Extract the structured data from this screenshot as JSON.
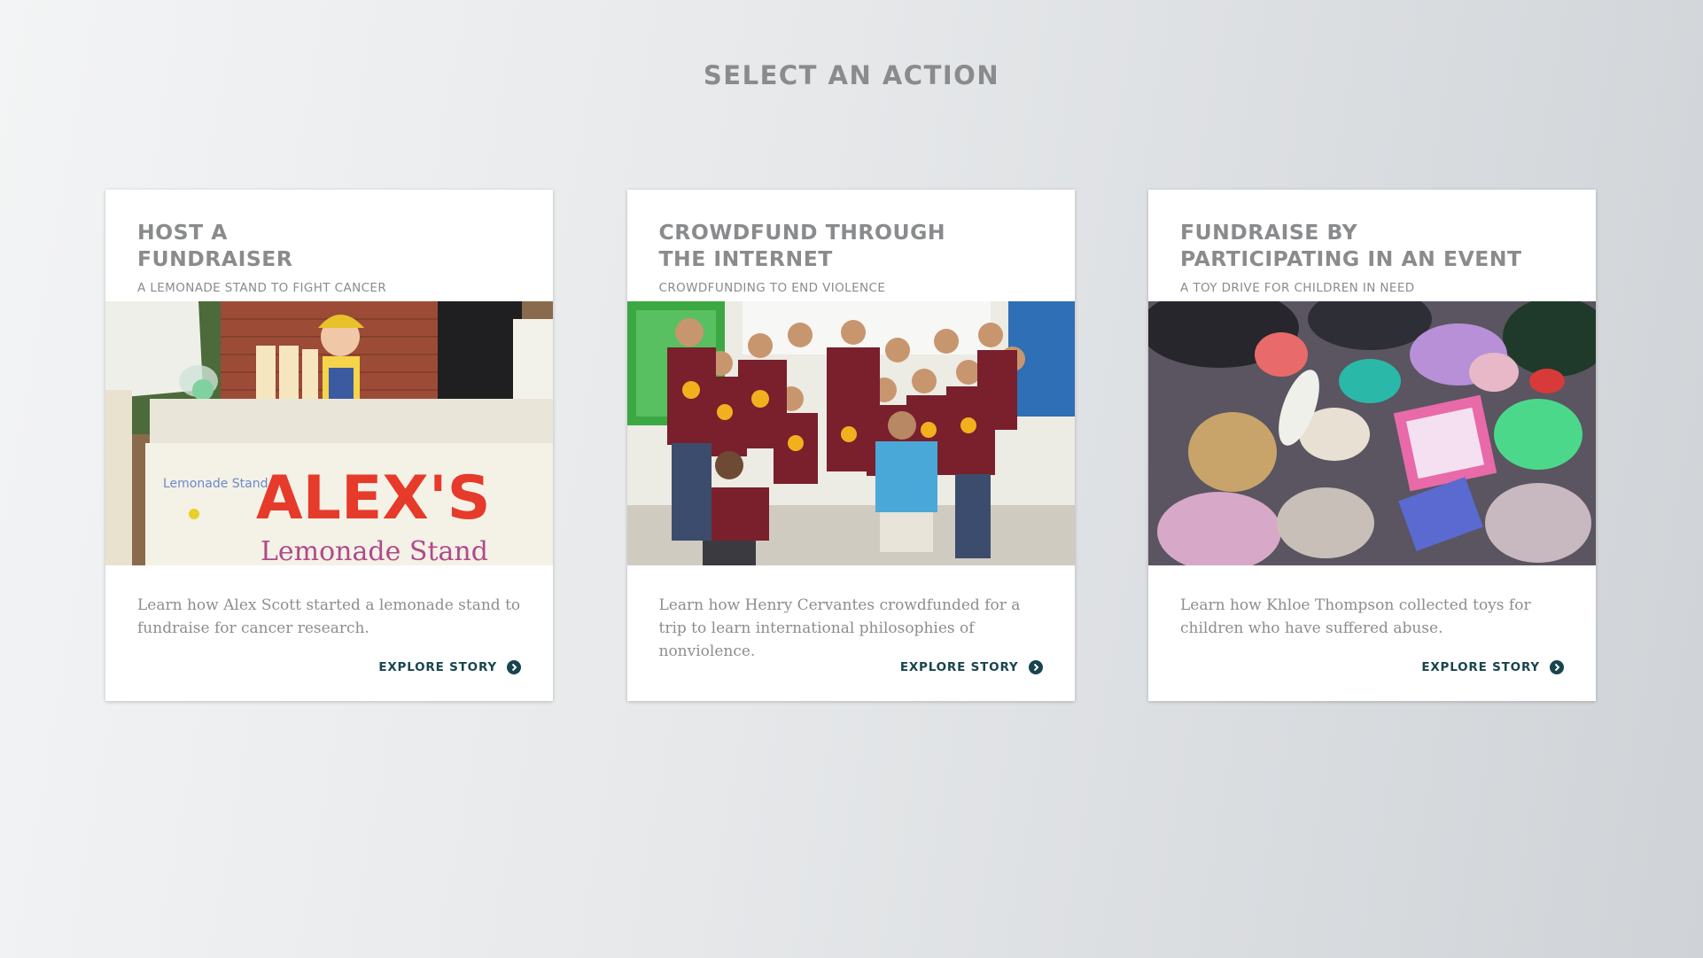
{
  "page": {
    "title": "SELECT AN ACTION"
  },
  "colors": {
    "heading_gray": "#8a8b8d",
    "link_teal": "#17444d",
    "card_bg": "#ffffff"
  },
  "cards": [
    {
      "title": "HOST A\nFUNDRAISER",
      "subtitle": "A LEMONADE STAND TO FIGHT CANCER",
      "image": "lemonade-stand-photo",
      "image_sign_text": "ALEX'S",
      "image_sign_subtext": "Lemonade Stand",
      "description": "Learn how Alex Scott started a lemonade stand to fundraise for cancer research.",
      "link_label": "EXPLORE STORY",
      "link_icon": "chevron-right-circle-icon"
    },
    {
      "title": "CROWDFUND THROUGH\nTHE INTERNET",
      "subtitle": "CROWDFUNDING TO END VIOLENCE",
      "image": "group-of-students-photo",
      "description": "Learn how Henry Cervantes crowdfunded for a trip to learn international philosophies of nonviolence.",
      "link_label": "EXPLORE STORY",
      "link_icon": "chevron-right-circle-icon"
    },
    {
      "title": "FUNDRAISE BY\nPARTICIPATING IN AN EVENT",
      "subtitle": "A TOY DRIVE FOR CHILDREN IN NEED",
      "image": "pile-of-toys-photo",
      "description": "Learn how Khloe Thompson collected toys for children who have suffered abuse.",
      "link_label": "EXPLORE STORY",
      "link_icon": "chevron-right-circle-icon"
    }
  ]
}
